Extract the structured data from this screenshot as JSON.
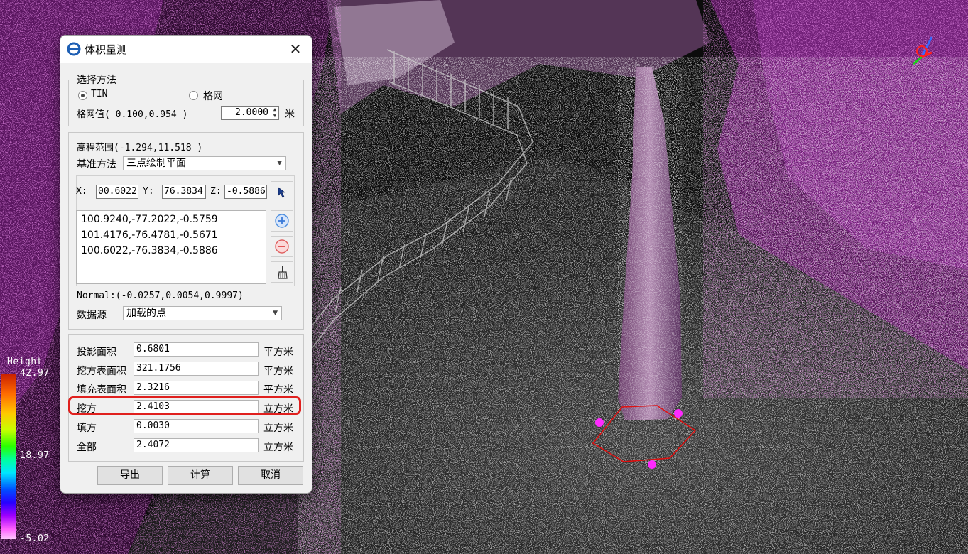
{
  "dialog": {
    "title": "体积量测",
    "close": "✕",
    "method_group": {
      "legend": "选择方法",
      "tin_label": "TIN",
      "grid_label": "格网",
      "selected": "TIN",
      "grid_value_label": "格网值( 0.100,0.954 )",
      "grid_value": "2.0000",
      "grid_unit": "米"
    },
    "reference_group": {
      "elevation_range": "高程范围(-1.294,11.518 )",
      "method_label": "基准方法",
      "method_value": "三点绘制平面",
      "x_label": "X:",
      "x_value": "00.6022",
      "y_label": "Y:",
      "y_value": "76.3834",
      "z_label": "Z:",
      "z_value": "-0.5886",
      "points": [
        "100.9240,-77.2022,-0.5759",
        "101.4176,-76.4781,-0.5671",
        "100.6022,-76.3834,-0.5886"
      ],
      "normal": "Normal:(-0.0257,0.0054,0.9997)",
      "source_label": "数据源",
      "source_value": "加载的点"
    },
    "results": [
      {
        "label": "投影面积",
        "value": "0.6801",
        "unit": "平方米"
      },
      {
        "label": "挖方表面积",
        "value": "321.1756",
        "unit": "平方米"
      },
      {
        "label": "填充表面积",
        "value": "2.3216",
        "unit": "平方米"
      },
      {
        "label": "挖方",
        "value": "2.4103",
        "unit": "立方米"
      },
      {
        "label": "填方",
        "value": "0.0030",
        "unit": "立方米"
      },
      {
        "label": "全部",
        "value": "2.4072",
        "unit": "立方米"
      }
    ],
    "buttons": {
      "export": "导出",
      "compute": "计算",
      "cancel": "取消"
    }
  },
  "colorbar": {
    "title": "Height",
    "max": "42.97",
    "mid": "18.97",
    "min": "-5.02"
  },
  "colors": {
    "highlight": "#e0201e",
    "polygon": "#e01010",
    "marker": "#ff2aff"
  }
}
